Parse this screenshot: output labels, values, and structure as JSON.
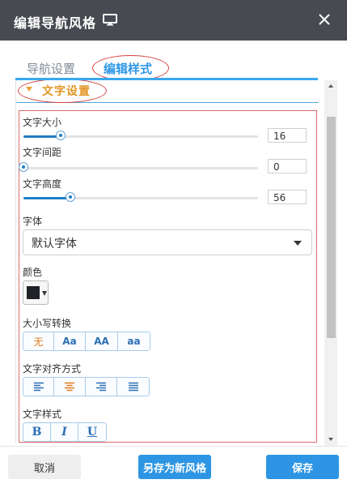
{
  "dialog": {
    "title": "编辑导航风格",
    "icons": {
      "title_icon": "monitor-icon",
      "close": "close-icon"
    }
  },
  "tabs": [
    {
      "label": "导航设置",
      "active": false
    },
    {
      "label": "编辑样式",
      "active": true
    }
  ],
  "section": {
    "title": "文字设置",
    "expanded": true,
    "font_size": {
      "label": "文字大小",
      "value": "16",
      "level": 0.16
    },
    "letter_spacing": {
      "label": "文字间距",
      "value": "0",
      "level": 0.0
    },
    "line_height": {
      "label": "文字高度",
      "value": "56",
      "level": 0.2
    },
    "font_family": {
      "label": "字体",
      "value": "默认字体"
    },
    "color": {
      "label": "颜色",
      "value": "#1f2328"
    },
    "text_transform": {
      "label": "大小写转换",
      "options": [
        "无",
        "Aa",
        "AA",
        "aa"
      ],
      "selected": "无"
    },
    "text_align": {
      "label": "文字对齐方式",
      "options": [
        "align-left-icon",
        "align-center-icon",
        "align-right-icon",
        "align-justify-icon"
      ],
      "selected": "align-center-icon"
    },
    "text_style": {
      "label": "文字样式",
      "options": [
        "B",
        "I",
        "U"
      ]
    }
  },
  "footer": {
    "cancel_label": "取消",
    "save_as_label": "另存为新风格",
    "save_label": "保存"
  },
  "colors": {
    "header_bg": "#474a51",
    "accent": "#2d95e3",
    "section_title": "#e39524",
    "annotation_red": "#d64545"
  }
}
